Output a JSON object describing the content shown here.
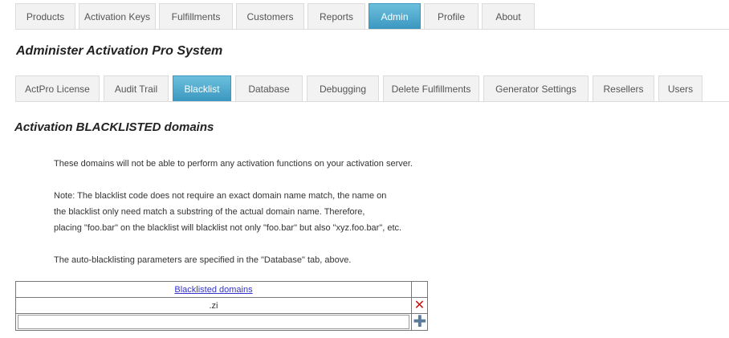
{
  "top_nav": {
    "tabs": [
      {
        "label": "Products"
      },
      {
        "label": "Activation Keys"
      },
      {
        "label": "Fulfillments"
      },
      {
        "label": "Customers"
      },
      {
        "label": "Reports"
      },
      {
        "label": "Admin",
        "active": true
      },
      {
        "label": "Profile"
      },
      {
        "label": "About"
      }
    ]
  },
  "page_title": "Administer Activation Pro System",
  "admin_nav": {
    "tabs": [
      {
        "label": "ActPro License"
      },
      {
        "label": "Audit Trail"
      },
      {
        "label": "Blacklist",
        "active": true
      },
      {
        "label": "Database"
      },
      {
        "label": "Debugging"
      },
      {
        "label": "Delete Fulfillments"
      },
      {
        "label": "Generator Settings"
      },
      {
        "label": "Resellers"
      },
      {
        "label": "Users"
      }
    ]
  },
  "section_title": "Activation BLACKLISTED domains",
  "intro_text": "These domains will not be able to perform any activation functions on your activation server.",
  "note_lines": [
    "Note: The blacklist code does not require an exact domain name match, the name on",
    "the blacklist only need match a substring of the actual domain name. Therefore,",
    "placing \"foo.bar\" on the blacklist will blacklist not only \"foo.bar\" but also \"xyz.foo.bar\", etc."
  ],
  "auto_text": "The auto-blacklisting parameters are specified in the \"Database\" tab, above.",
  "blacklist": {
    "header": "Blacklisted domains",
    "rows": [
      ".zi"
    ],
    "new_value": ""
  },
  "icons": {
    "delete": "close-x-icon",
    "add": "plus-icon"
  },
  "colors": {
    "active_tab": "#3b97c0",
    "delete_icon": "#d01010",
    "add_icon": "#5b7b9a",
    "link": "#3333cc"
  }
}
